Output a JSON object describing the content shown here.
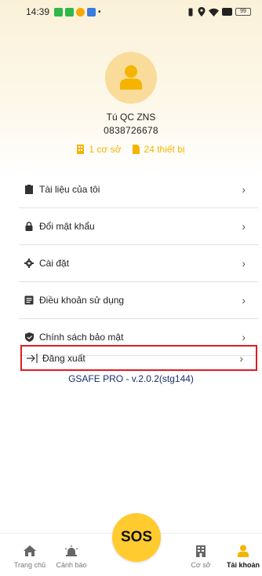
{
  "status_bar": {
    "time": "14:39",
    "battery": "99"
  },
  "profile": {
    "name": "Tú QC ZNS",
    "phone": "0838726678"
  },
  "stats": {
    "facilities": "1 cơ sở",
    "devices": "24 thiết bị"
  },
  "menu": [
    {
      "label": "Tài liệu của tôi",
      "icon": "document-icon"
    },
    {
      "label": "Đổi mật khẩu",
      "icon": "lock-icon"
    },
    {
      "label": "Cài đặt",
      "icon": "gear-icon"
    },
    {
      "label": "Điều khoản sử dụng",
      "icon": "book-icon"
    },
    {
      "label": "Chính sách bảo mật",
      "icon": "shield-icon"
    }
  ],
  "logout": {
    "label": "Đăng xuất",
    "icon": "logout-icon"
  },
  "version": "GSAFE PRO - v.2.0.2(stg144)",
  "tabs": {
    "home": "Trang chủ",
    "alert": "Cảnh báo",
    "sos": "SOS",
    "facility": "Cơ sở",
    "account": "Tài khoản"
  },
  "colors": {
    "accent": "#f5b400",
    "avatar_bg": "#f9dc9a",
    "highlight_border": "#e01b24",
    "version_text": "#1a2d6b",
    "sos_bg": "#ffcb2f"
  }
}
